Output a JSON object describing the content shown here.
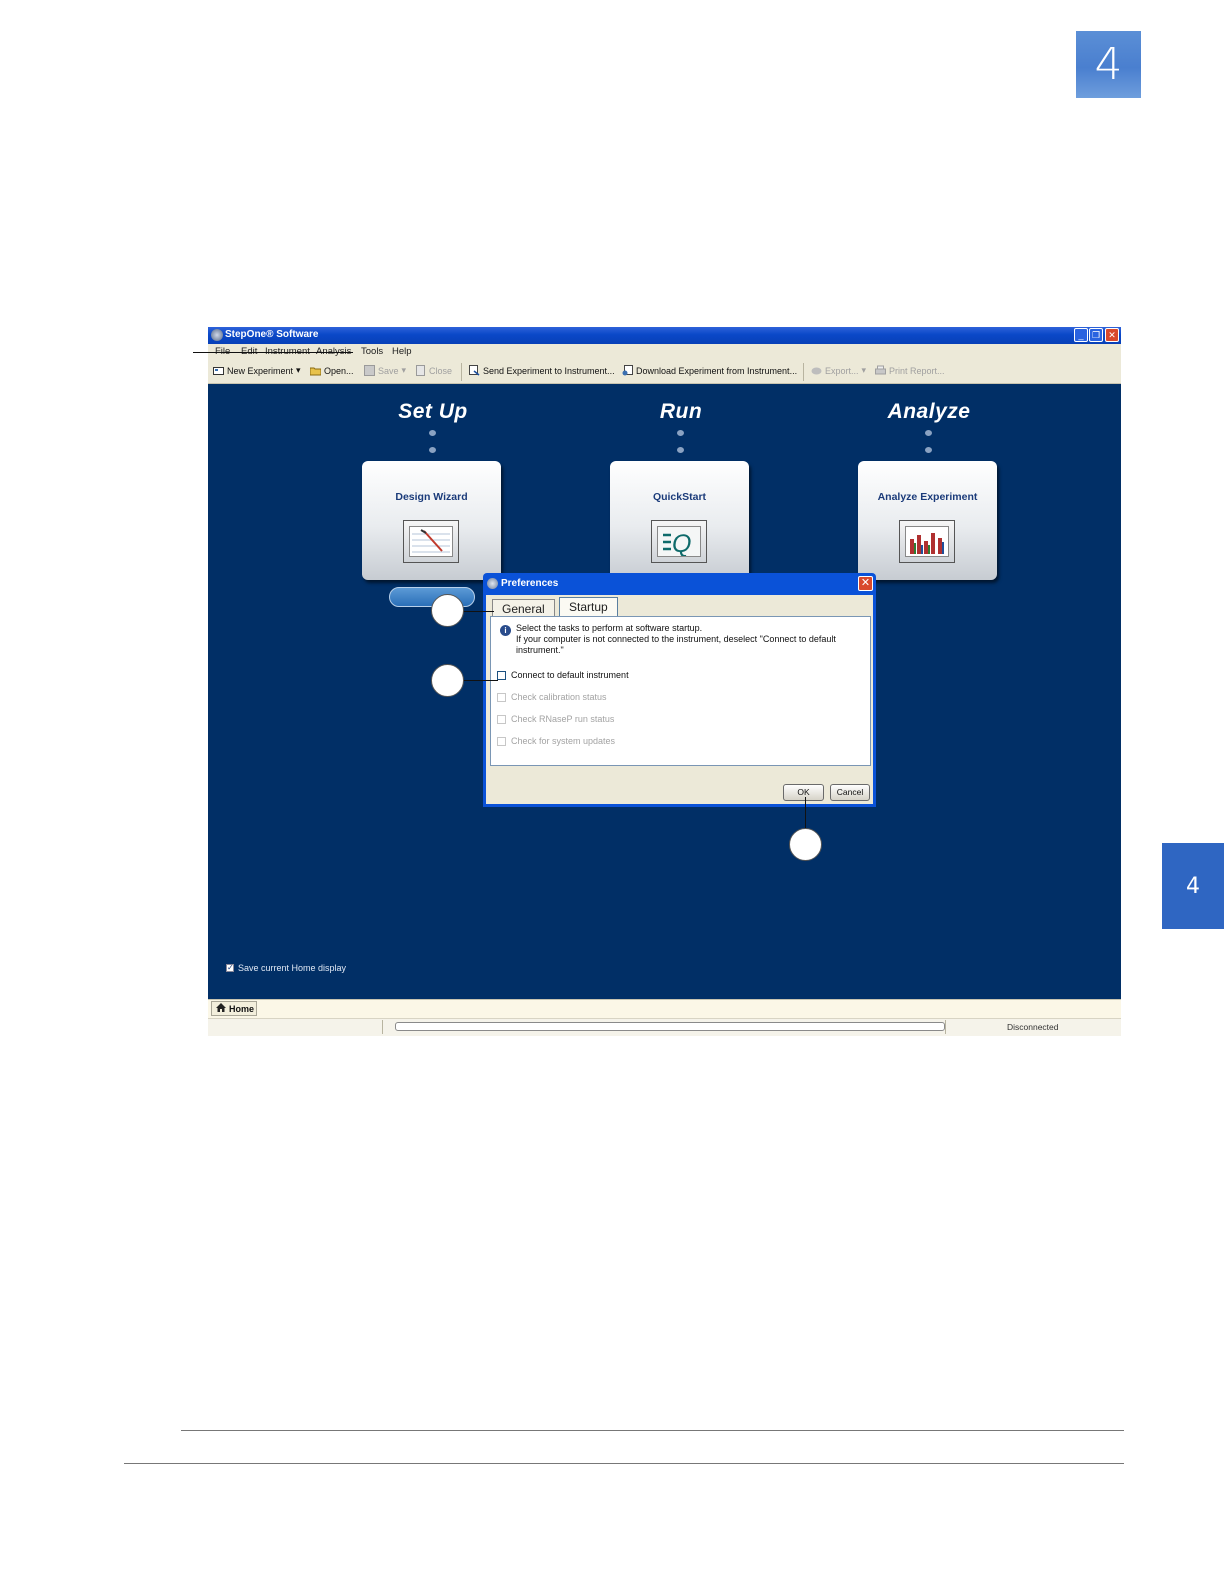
{
  "page": {
    "chapter_number": "4",
    "side_tab_number": "4"
  },
  "window": {
    "title": "StepOne® Software"
  },
  "menu": [
    "File",
    "Edit",
    "Instrument",
    "Analysis",
    "Tools",
    "Help"
  ],
  "toolbar": {
    "new_experiment": "New Experiment",
    "open": "Open...",
    "save": "Save",
    "close": "Close",
    "send": "Send Experiment to Instrument...",
    "download": "Download Experiment from Instrument...",
    "export": "Export...",
    "print": "Print Report..."
  },
  "home": {
    "headings": [
      "Set Up",
      "Run",
      "Analyze"
    ],
    "cards": [
      "Design Wizard",
      "QuickStart",
      "Analyze Experiment"
    ],
    "save_display": "Save current Home display",
    "home_tab": "Home",
    "status": "Disconnected"
  },
  "dialog": {
    "title": "Preferences",
    "tabs": [
      "General",
      "Startup"
    ],
    "info_line1": "Select the tasks to perform at software startup.",
    "info_line2": "If your computer is not connected to the instrument, deselect \"Connect to default instrument.\"",
    "options": [
      {
        "label": "Connect to default instrument",
        "checked": false,
        "enabled": true
      },
      {
        "label": "Check calibration status",
        "checked": false,
        "enabled": false
      },
      {
        "label": "Check RNaseP run status",
        "checked": false,
        "enabled": false
      },
      {
        "label": "Check for system updates",
        "checked": false,
        "enabled": false
      }
    ],
    "ok": "OK",
    "cancel": "Cancel"
  },
  "colors": {
    "app_background": "#012f66",
    "title_bar": "#0a48c8",
    "chapter_blue": "#4a7fcf"
  }
}
